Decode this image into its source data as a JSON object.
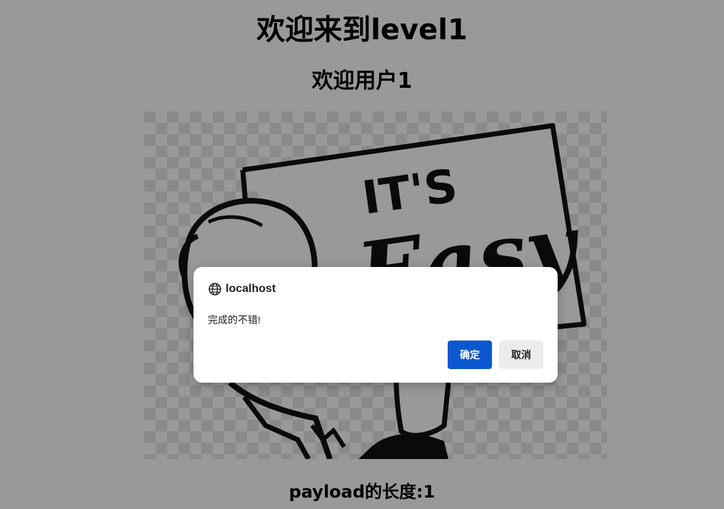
{
  "page": {
    "heading": "欢迎来到level1",
    "welcome": "欢迎用户1",
    "payload_length": "payload的长度:1"
  },
  "picture": {
    "sign_text_top": "IT'S",
    "sign_text_script": "Easy"
  },
  "dialog": {
    "origin": "localhost",
    "message": "完成的不错!",
    "ok_label": "确定",
    "cancel_label": "取消",
    "ok_color": "#0b57d0"
  },
  "colors": {
    "overlay": "rgba(0,0,0,0.4)",
    "page_bg": "#ffffff"
  }
}
